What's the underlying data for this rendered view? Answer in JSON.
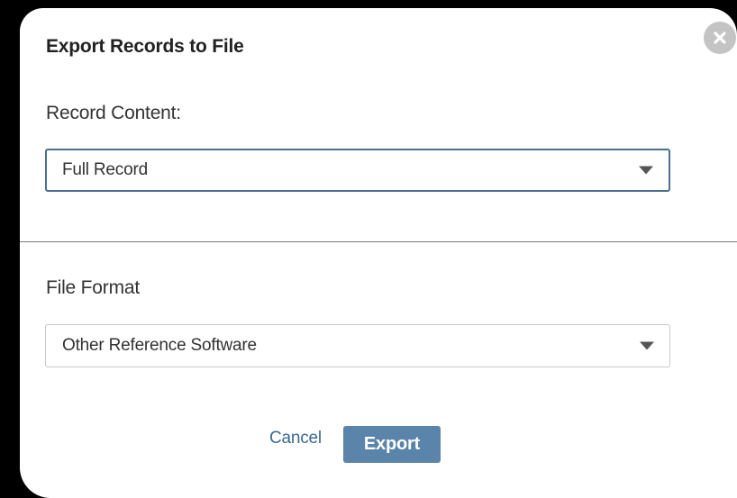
{
  "dialog": {
    "title": "Export Records to File",
    "close_icon": "close-icon"
  },
  "record_content": {
    "label": "Record Content:",
    "selected": "Full Record",
    "icon": "chevron-down-icon"
  },
  "file_format": {
    "label": "File Format",
    "selected": "Other Reference Software",
    "icon": "chevron-down-icon"
  },
  "actions": {
    "cancel_label": "Cancel",
    "export_label": "Export"
  },
  "colors": {
    "backdrop": "#000000",
    "focus_border": "#4a6f93",
    "link": "#3b6a8f",
    "primary_button": "#5b84ab",
    "close_button": "#c4c4c4"
  }
}
